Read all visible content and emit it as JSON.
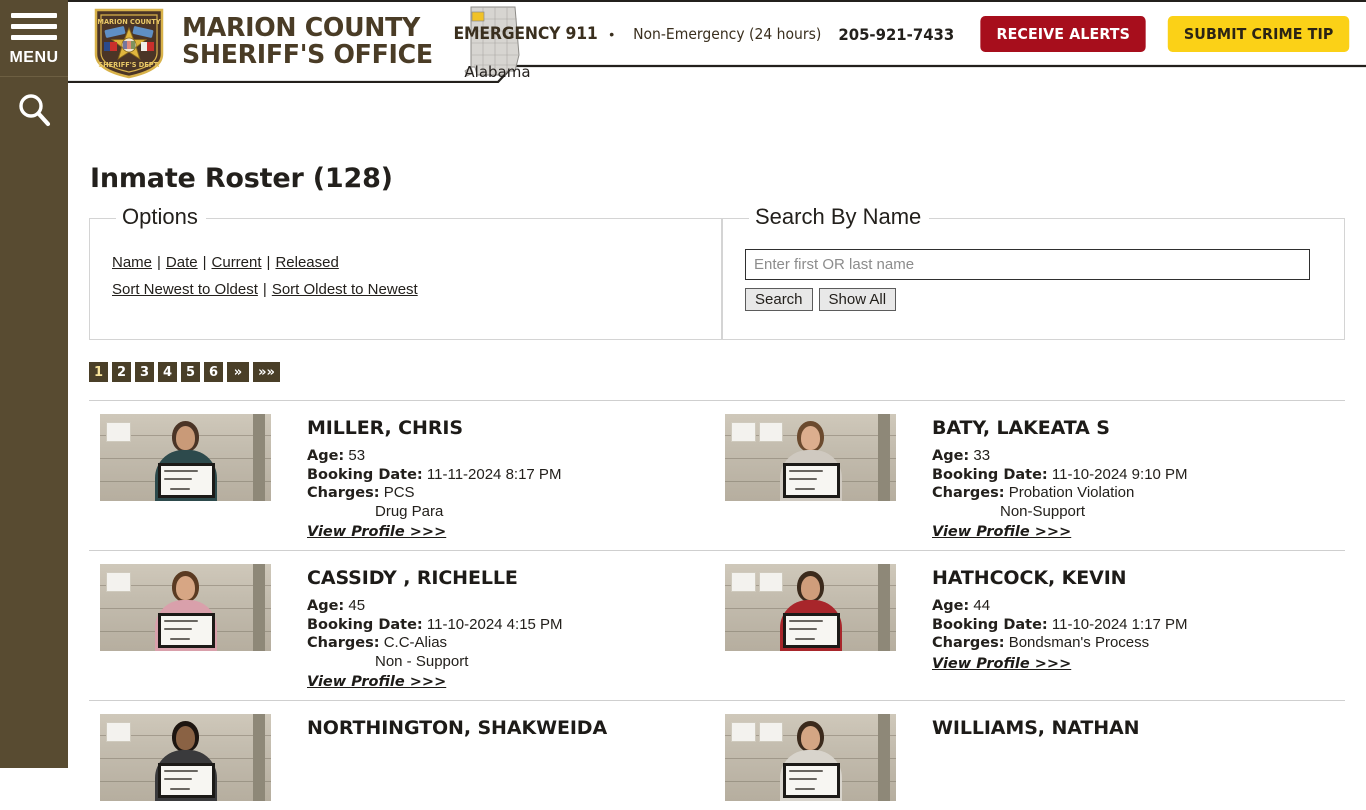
{
  "sidebar": {
    "menu_label": "MENU",
    "menu_icon": "hamburger-icon",
    "search_icon": "search-icon"
  },
  "header": {
    "agency_line1": "MARION COUNTY",
    "agency_line2": "SHERIFF'S OFFICE",
    "badge_icon": "sheriff-badge-icon",
    "state_map_icon": "alabama-state-map-icon",
    "state_label": "Alabama",
    "emergency_label": "EMERGENCY 911",
    "bullet": "•",
    "non_emergency_label": "Non-Emergency (24 hours)",
    "non_emergency_phone": "205-921-7433",
    "receive_alerts_label": "RECEIVE ALERTS",
    "submit_tip_label": "SUBMIT CRIME TIP",
    "colors": {
      "alert_red": "#a70e1c",
      "tip_yellow": "#fbd117",
      "brand_brown": "#4a3c26",
      "sidebar_brown": "#584b31"
    }
  },
  "main": {
    "page_title": "Inmate Roster (128)",
    "options": {
      "legend": "Options",
      "links": [
        "Name",
        "Date",
        "Current",
        "Released"
      ],
      "sort_links": [
        "Sort Newest to Oldest",
        "Sort Oldest to Newest"
      ],
      "separator": "|"
    },
    "search": {
      "legend": "Search By Name",
      "placeholder": "Enter first OR last name",
      "value": "",
      "search_label": "Search",
      "show_all_label": "Show All"
    },
    "pagination": {
      "pages": [
        "1",
        "2",
        "3",
        "4",
        "5",
        "6"
      ],
      "next_label": "»",
      "last_label": "»»",
      "active": "1"
    },
    "labels": {
      "age": "Age:",
      "booking_date": "Booking Date:",
      "charges": "Charges:",
      "view_profile": "View Profile >>>"
    },
    "roster": [
      [
        {
          "name": "MILLER, CHRIS",
          "age": "53",
          "booking_date": "11-11-2024 8:17 PM",
          "charges": [
            "PCS",
            "Drug Para"
          ],
          "mug_board_text": "Miller, Chris\nPCS, Drug Para\n11-11-24",
          "shirt_color": "#2d4a4c",
          "skin_color": "#c99a78",
          "hair_color": "#4a3426"
        },
        {
          "name": "BATY, LAKEATA S",
          "age": "33",
          "booking_date": "11-10-2024 9:10 PM",
          "charges": [
            "Probation Violation",
            "Non-Support"
          ],
          "mug_board_text": "Baty, Lakeata\nPV\nNon-Support\n11-10-24",
          "shirt_color": "#cfc9c0",
          "skin_color": "#dcae8e",
          "hair_color": "#6b4a2e"
        }
      ],
      [
        {
          "name": "CASSIDY , RICHELLE",
          "age": "45",
          "booking_date": "11-10-2024 4:15 PM",
          "charges": [
            "C.C-Alias",
            "Non - Support"
          ],
          "mug_board_text": "Cassidy, Richelle\nC.C-Alias, Non-Support\n11-10-24",
          "shirt_color": "#d9a0ab",
          "skin_color": "#d7a684",
          "hair_color": "#5a3a22"
        },
        {
          "name": "HATHCOCK, KEVIN",
          "age": "44",
          "booking_date": "11-10-2024 1:17 PM",
          "charges": [
            "Bondsman's Process"
          ],
          "mug_board_text": "Hathcock, Kevin\nBondsman's Process\n11-10-24",
          "shirt_color": "#a8262b",
          "skin_color": "#cf9d7b",
          "hair_color": "#3b2a1c"
        }
      ],
      [
        {
          "name": "NORTHINGTON, SHAKWEIDA",
          "age": "",
          "booking_date": "",
          "charges": [],
          "mug_board_text": "",
          "shirt_color": "#3a3a3c",
          "skin_color": "#8a6244",
          "hair_color": "#1d1510"
        },
        {
          "name": "WILLIAMS, NATHAN",
          "age": "",
          "booking_date": "",
          "charges": [],
          "mug_board_text": "",
          "shirt_color": "#d8d4cc",
          "skin_color": "#d4a684",
          "hair_color": "#3b2a1c"
        }
      ]
    ]
  }
}
